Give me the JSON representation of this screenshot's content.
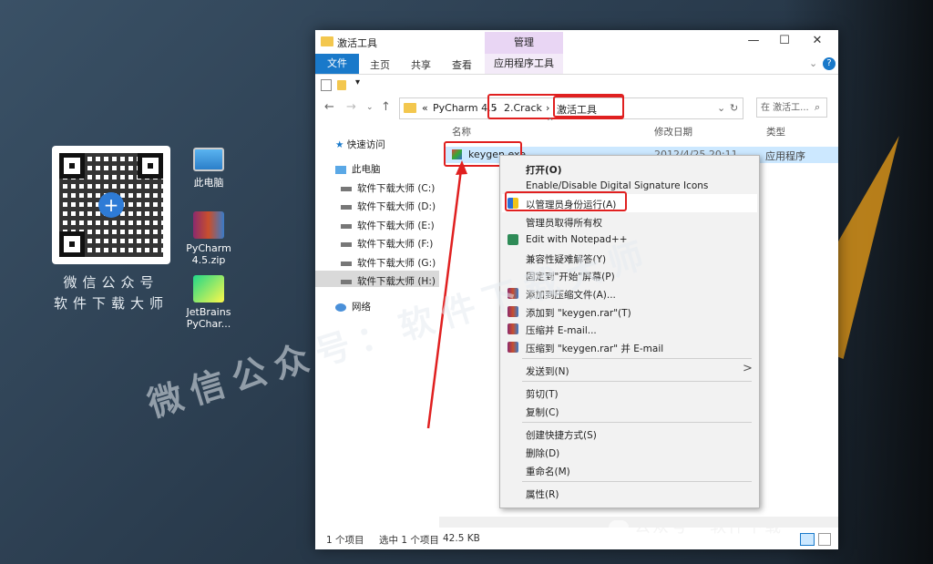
{
  "desktop": {
    "qr_caption_line1": "微信公众号",
    "qr_caption_line2": "软件下载大师",
    "icons": [
      {
        "label1": "此电脑",
        "label2": ""
      },
      {
        "label1": "PyCharm",
        "label2": "4.5.zip"
      },
      {
        "label1": "JetBrains",
        "label2": "PyChar..."
      }
    ],
    "watermark_big": "微信公众号：软件下载大师",
    "watermark_bottom": "公众号 · 软件下载"
  },
  "window": {
    "title": "激活工具",
    "manage_tab": "管理",
    "controls": {
      "minimize": "—",
      "maximize": "☐",
      "close": "✕"
    },
    "ribbon_tabs": {
      "file": "文件",
      "home": "主页",
      "share": "共享",
      "view": "查看",
      "app_tools": "应用程序工具"
    },
    "help": "?",
    "address": {
      "prefix": "«",
      "crumbs": [
        "PyCharm 4.5",
        "2.Crack",
        "激活工具"
      ],
      "search_placeholder": "在 激活工..."
    },
    "nav": {
      "quick_access": "快速访问",
      "this_pc": "此电脑",
      "drives": [
        "软件下载大师 (C:)",
        "软件下载大师 (D:)",
        "软件下载大师 (E:)",
        "软件下载大师 (F:)",
        "软件下载大师 (G:)",
        "软件下载大师 (H:)"
      ],
      "network": "网络"
    },
    "columns": {
      "name": "名称",
      "modified": "修改日期",
      "type": "类型"
    },
    "file": {
      "name": "keygen.exe",
      "modified": "2012/4/25 20:11",
      "type": "应用程序"
    },
    "status": {
      "count": "1 个项目",
      "selected": "选中 1 个项目",
      "size": "42.5 KB"
    }
  },
  "context_menu": {
    "items": [
      "打开(O)",
      "Enable/Disable Digital Signature Icons",
      "以管理员身份运行(A)",
      "管理员取得所有权",
      "Edit with Notepad++",
      "兼容性疑难解答(Y)",
      "固定到\"开始\"屏幕(P)",
      "添加到压缩文件(A)...",
      "添加到 \"keygen.rar\"(T)",
      "压缩并 E-mail...",
      "压缩到 \"keygen.rar\" 并 E-mail",
      "发送到(N)",
      "剪切(T)",
      "复制(C)",
      "创建快捷方式(S)",
      "删除(D)",
      "重命名(M)",
      "属性(R)"
    ],
    "submenu_arrow": ">"
  },
  "colors": {
    "accent": "#1979ca",
    "highlight": "#e02020",
    "selection": "#cce8ff"
  }
}
